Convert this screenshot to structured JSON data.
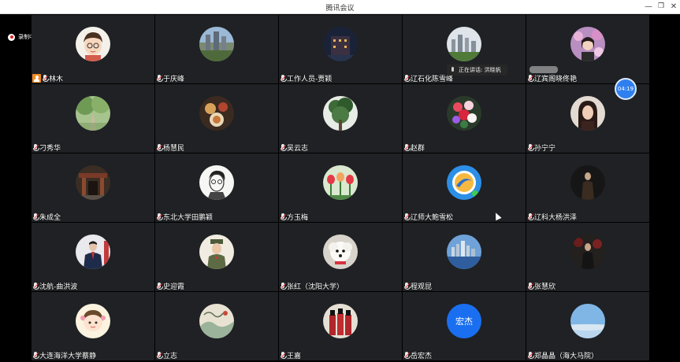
{
  "window": {
    "title": "腾讯会议",
    "minimize_label": "—",
    "maximize_label": "❐",
    "close_label": "✕"
  },
  "recording": {
    "label": "录制中"
  },
  "speaking": {
    "label": "正在讲话: 洪晓帆"
  },
  "timer": {
    "label": "04:19"
  },
  "participants": [
    {
      "name": "林木",
      "host": true,
      "avatar": "cartoon-boy"
    },
    {
      "name": "于庆峰",
      "host": false,
      "avatar": "city-photo"
    },
    {
      "name": "工作人员-贾颖",
      "host": false,
      "avatar": "night-building"
    },
    {
      "name": "辽石化陈雪峰",
      "host": false,
      "avatar": "skyline"
    },
    {
      "name": "辽宾阁晓佟艳",
      "host": false,
      "avatar": "portrait-flowers"
    },
    {
      "name": "刁秀华",
      "host": false,
      "avatar": "tree-path"
    },
    {
      "name": "杨慧民",
      "host": false,
      "avatar": "food"
    },
    {
      "name": "吴云志",
      "host": false,
      "avatar": "tree"
    },
    {
      "name": "赵群",
      "host": false,
      "avatar": "flowers"
    },
    {
      "name": "孙宁宁",
      "host": false,
      "avatar": "portrait-woman"
    },
    {
      "name": "朱成全",
      "host": false,
      "avatar": "gate"
    },
    {
      "name": "东北大学田鹏颖",
      "host": false,
      "avatar": "sketch-man"
    },
    {
      "name": "方玉梅",
      "host": false,
      "avatar": "tulips"
    },
    {
      "name": "辽师大鲍雪松",
      "host": false,
      "avatar": "blue-logo"
    },
    {
      "name": "辽科大杨洪泽",
      "host": false,
      "avatar": "dark-figure"
    },
    {
      "name": "沈航-曲洪波",
      "host": false,
      "avatar": "suit-man"
    },
    {
      "name": "史迎霞",
      "host": false,
      "avatar": "soldier"
    },
    {
      "name": "张红（沈阳大学）",
      "host": false,
      "avatar": "dog"
    },
    {
      "name": "程观昆",
      "host": false,
      "avatar": "waterfront"
    },
    {
      "name": "张慧欣",
      "host": false,
      "avatar": "dark-man"
    },
    {
      "name": "大连海洋大学蔡静",
      "host": false,
      "avatar": "cartoon-girl"
    },
    {
      "name": "立志",
      "host": false,
      "avatar": "painting"
    },
    {
      "name": "王嘉",
      "host": false,
      "avatar": "red-guards"
    },
    {
      "name": "岳宏杰",
      "host": false,
      "avatar": "text",
      "avatar_text": "宏杰"
    },
    {
      "name": "郑晶晶（海大马院）",
      "host": false,
      "avatar": "sky"
    }
  ],
  "colors": {
    "tile_bg": "#1f2124",
    "host_badge": "#f28a1f",
    "timer_bg": "#2f7fef",
    "text_avatar": "#1a6ff0"
  }
}
